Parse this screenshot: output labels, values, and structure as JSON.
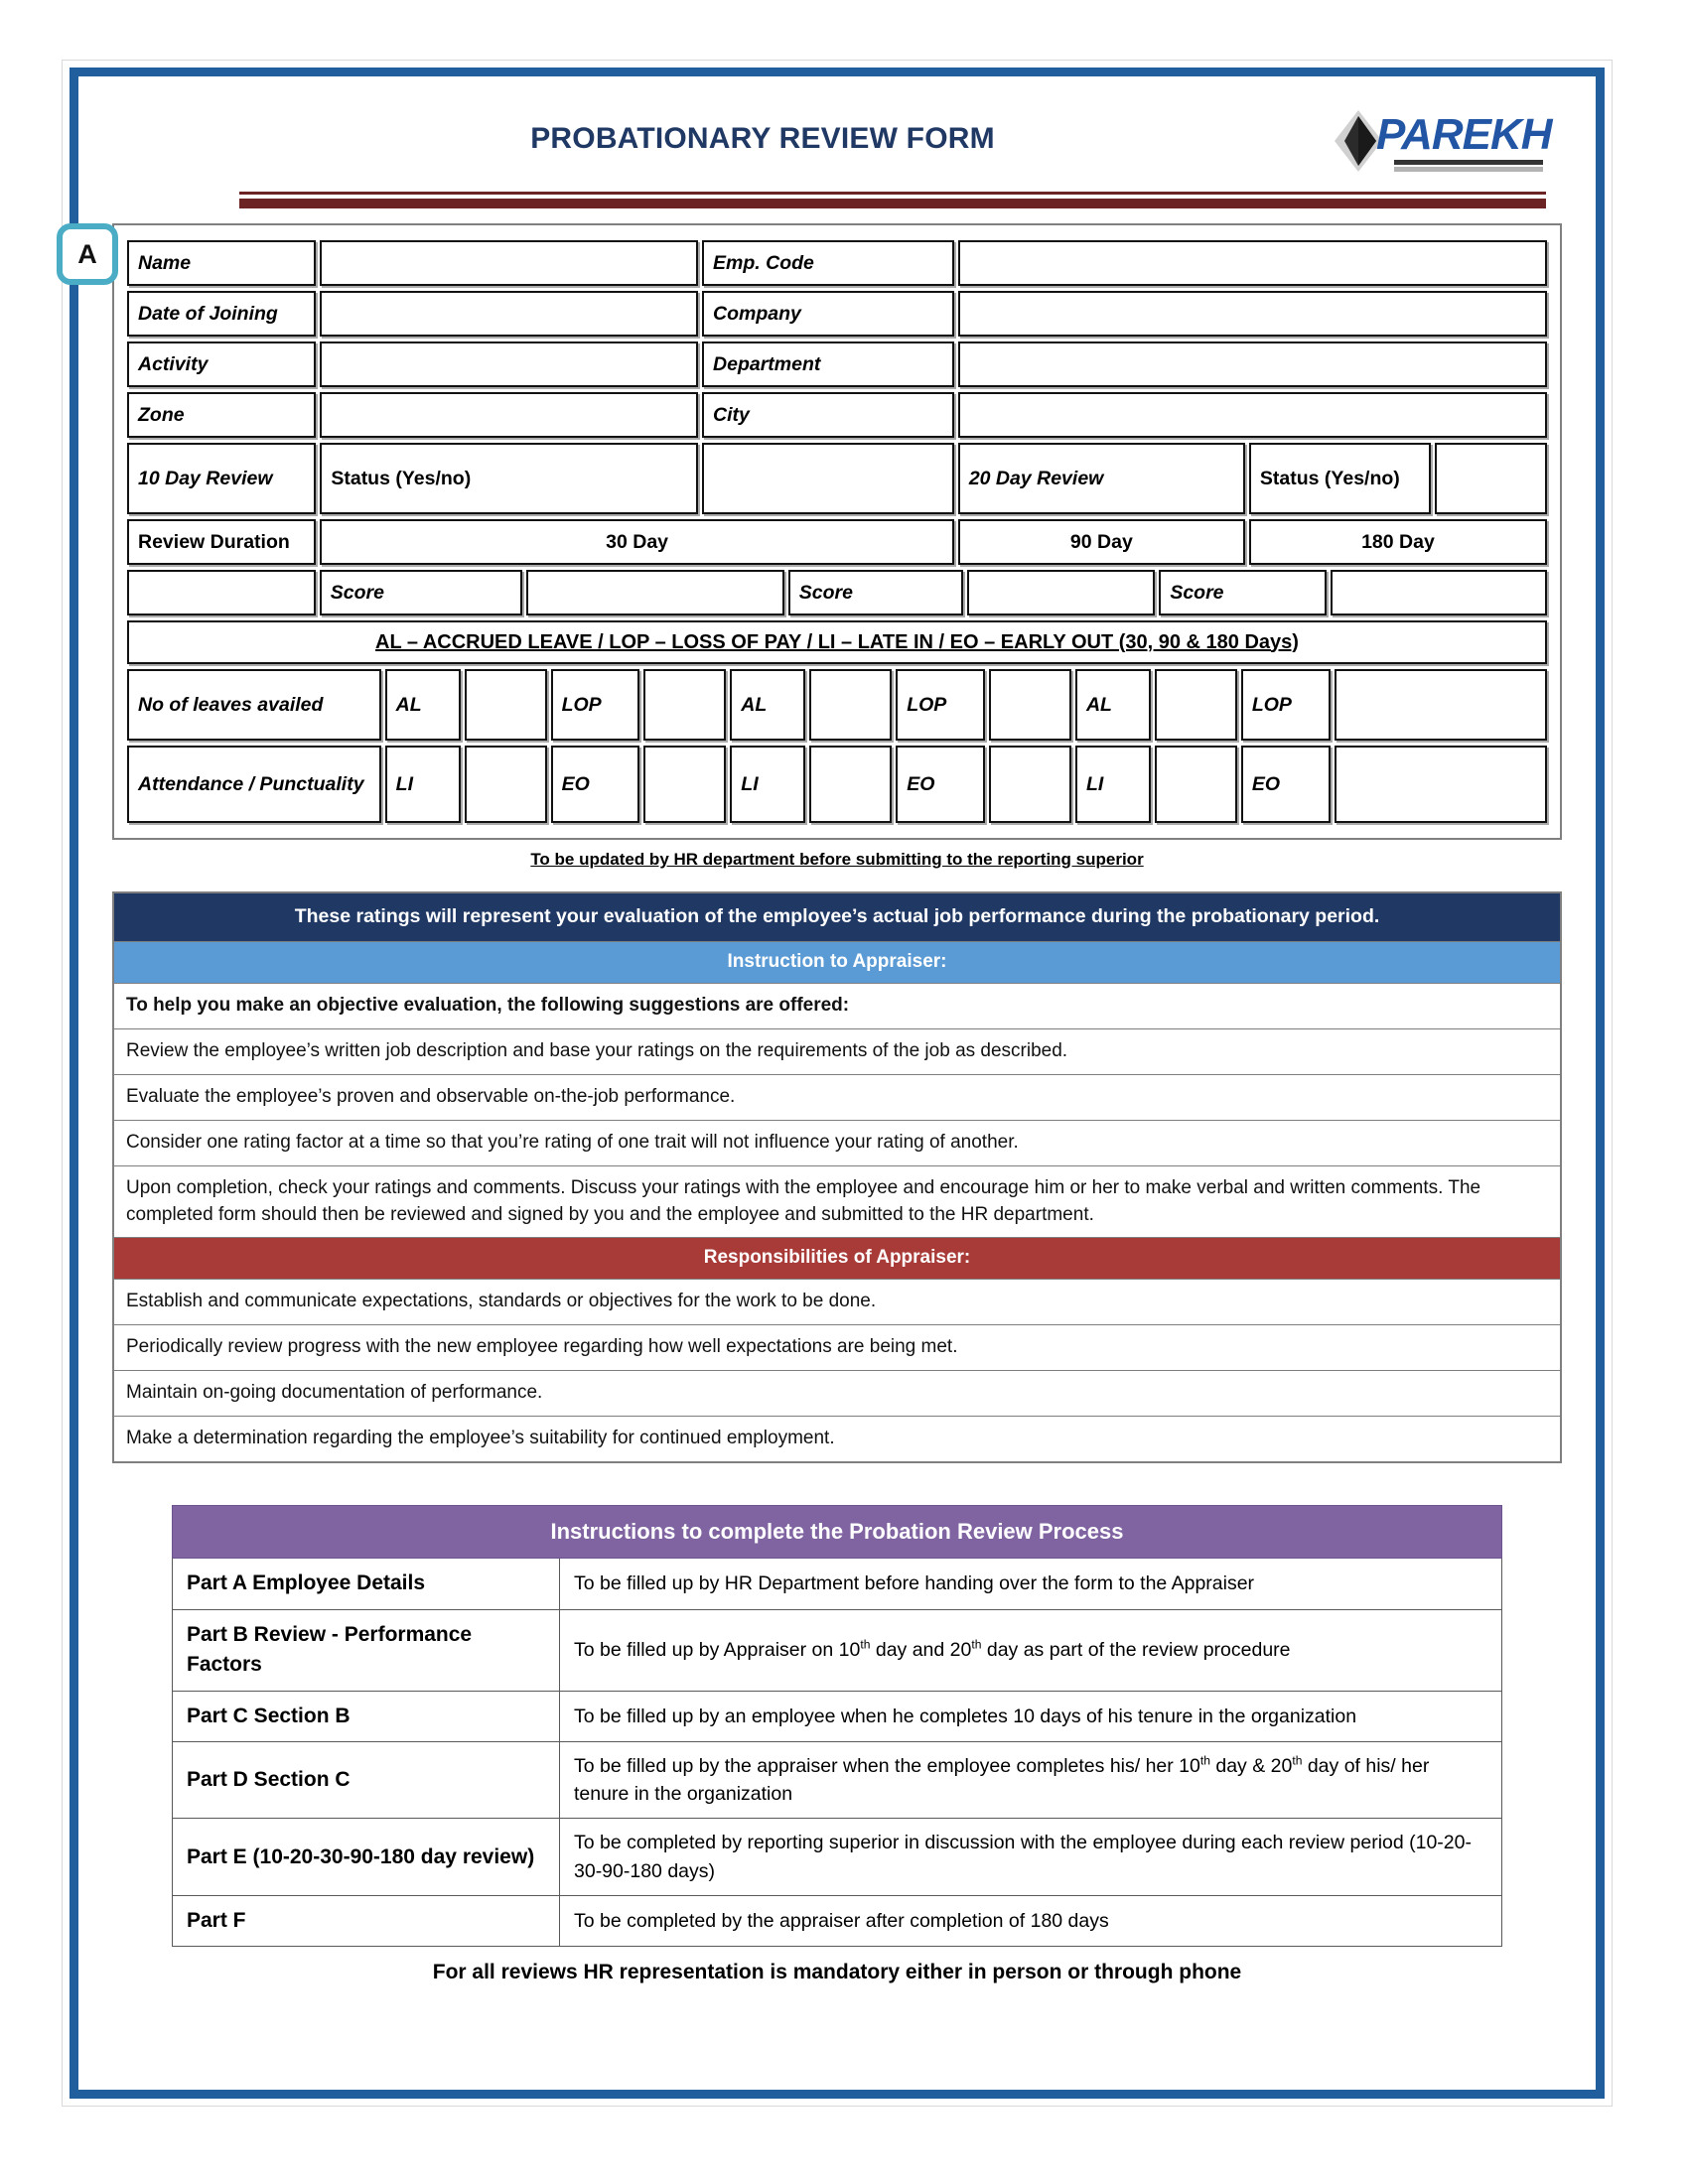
{
  "header": {
    "title": "PROBATIONARY REVIEW FORM",
    "logo_text": "PAREKH",
    "part_marker": "A"
  },
  "employee_form": {
    "rows": [
      {
        "left_label": "Name",
        "right_label": "Emp. Code"
      },
      {
        "left_label": "Date of Joining",
        "right_label": "Company"
      },
      {
        "left_label": "Activity",
        "right_label": "Department"
      },
      {
        "left_label": "Zone",
        "right_label": "City"
      }
    ],
    "review_row": {
      "label_10day": "10 Day Review",
      "status_10day": "Status (Yes/no)",
      "label_20day": "20 Day Review",
      "status_20day": "Status (Yes/no)"
    },
    "duration_row": {
      "label": "Review Duration",
      "d30": "30 Day",
      "d90": "90 Day",
      "d180": "180 Day"
    },
    "score_row": {
      "score1": "Score",
      "score2": "Score",
      "score3": "Score"
    },
    "legend_banner": "AL – ACCRUED LEAVE / LOP – LOSS OF PAY / LI – LATE IN / EO – EARLY OUT (30, 90 & 180 Days)",
    "leaves_row": {
      "label": "No of leaves availed",
      "codes": [
        "AL",
        "LOP",
        "AL",
        "LOP",
        "AL",
        "LOP"
      ]
    },
    "attendance_row": {
      "label": "Attendance / Punctuality",
      "codes": [
        "LI",
        "EO",
        "LI",
        "EO",
        "LI",
        "EO"
      ]
    },
    "hr_note": "To be updated by HR department before submitting to the reporting superior"
  },
  "instructions": {
    "intro_banner": "These ratings will represent your evaluation of the employee’s actual job performance during the probationary period.",
    "appraiser_header": "Instruction to Appraiser:",
    "appraiser_lead": "To help you make an objective evaluation, the following suggestions are offered:",
    "appraiser_items": [
      "Review the employee’s written job description and base your ratings on the requirements of the job as described.",
      "Evaluate the employee’s proven and observable on-the-job performance.",
      "Consider one rating factor at a time so that you’re rating of one trait will not influence your rating of another.",
      "Upon completion, check your ratings and comments. Discuss your ratings with the employee and encourage him or her to make verbal and written comments. The completed form should then be reviewed and signed by you and the employee and submitted to the HR department."
    ],
    "responsibilities_header": "Responsibilities of Appraiser:",
    "responsibilities_items": [
      "Establish and communicate expectations, standards or objectives for the work to be done.",
      "Periodically review progress with the new employee regarding how well expectations are being met.",
      "Maintain on-going documentation of performance.",
      "Make a determination regarding the employee’s suitability for continued employment."
    ]
  },
  "process": {
    "title": "Instructions to complete the Probation Review Process",
    "rows": [
      {
        "part": "Part A Employee Details",
        "desc_html": "To be filled up by HR Department before handing over the form to the Appraiser"
      },
      {
        "part": "Part B Review - Performance Factors",
        "desc_html": "To be filled up by Appraiser on 10<sup>th</sup> day and 20<sup>th</sup> day as part of the review procedure"
      },
      {
        "part": "Part C Section B",
        "desc_html": "To be filled up by an employee when he completes 10 days of his tenure in the organization"
      },
      {
        "part": "Part D Section C",
        "desc_html": "To be filled up by the appraiser when the employee completes his/ her 10<sup>th</sup> day &amp; 20<sup>th</sup> day of his/ her tenure in the organization"
      },
      {
        "part": "Part E (10-20-30-90-180 day review)",
        "desc_html": "To be completed by reporting superior in discussion with the employee during each review period (10-20-30-90-180 days)"
      },
      {
        "part": "Part F",
        "desc_html": "To be completed by the appraiser after completion of 180 days"
      }
    ],
    "footer_note": "For all reviews HR representation is mandatory either in person or through phone"
  },
  "colors": {
    "page_border": "#215E9E",
    "title_navy": "#1F3864",
    "rule_dark_red": "#6B2323",
    "banner_navy": "#1F3864",
    "banner_blue": "#5B9BD5",
    "banner_red": "#A83B38",
    "process_purple": "#8064A2",
    "marker_cyan": "#4BACC6",
    "logo_blue": "#2255A4"
  }
}
